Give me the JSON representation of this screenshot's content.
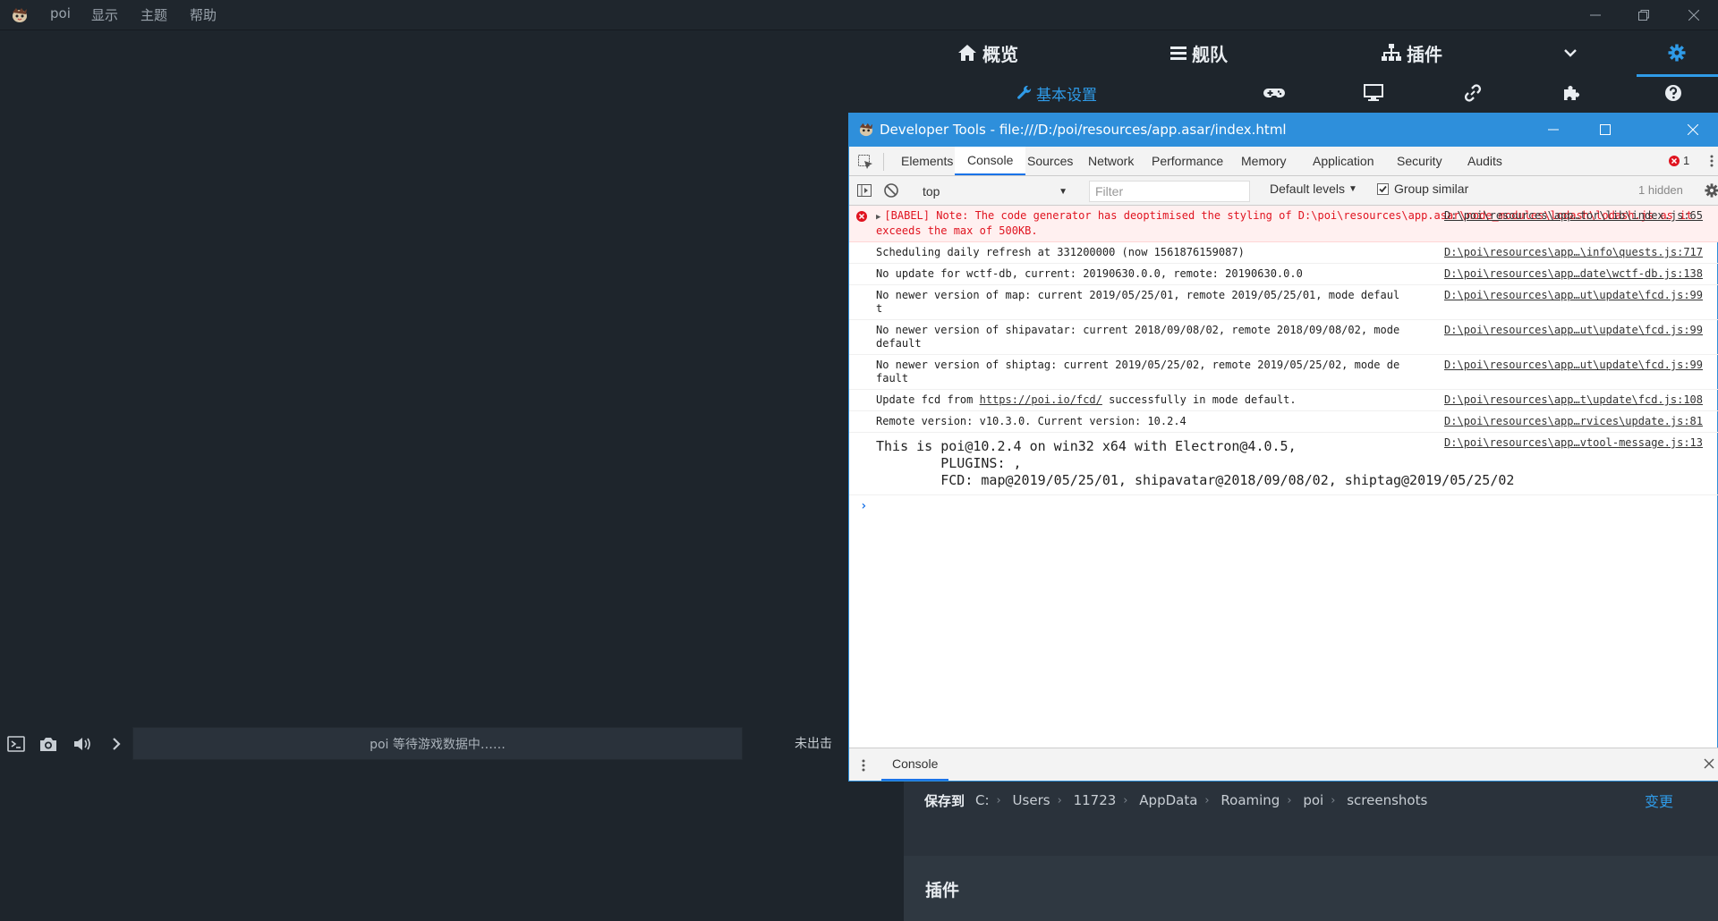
{
  "app": {
    "menu": [
      "poi",
      "显示",
      "主题",
      "帮助"
    ],
    "window_controls": [
      "minimize",
      "restore",
      "close"
    ]
  },
  "nav": {
    "tabs": [
      {
        "label": "概览",
        "icon": "home-icon"
      },
      {
        "label": "舰队",
        "icon": "list-icon"
      },
      {
        "label": "插件",
        "icon": "sitemap-icon"
      }
    ],
    "dropdown_icon": "chevron-down-icon",
    "settings_icon": "gear-icon",
    "subtabs": [
      {
        "label": "基本设置",
        "icon": "wrench-icon",
        "active": true
      },
      {
        "label": "",
        "icon": "gamepad-icon"
      },
      {
        "label": "",
        "icon": "monitor-icon"
      },
      {
        "label": "",
        "icon": "link-icon"
      },
      {
        "label": "",
        "icon": "puzzle-icon"
      },
      {
        "label": "",
        "icon": "question-icon"
      }
    ],
    "accent_color": "#2f9be8"
  },
  "game": {
    "status_text": "poi 等待游戏数据中……",
    "combat_status": "未出击",
    "toolbar_icons": [
      "terminal-icon",
      "camera-icon",
      "volume-icon",
      "chevron-right-icon"
    ]
  },
  "settings": {
    "save_label": "保存到",
    "path": [
      "C:",
      "Users",
      "11723",
      "AppData",
      "Roaming",
      "poi",
      "screenshots"
    ],
    "change_label": "变更",
    "plugins_heading": "插件"
  },
  "devtools": {
    "title": "Developer Tools - file:///D:/poi/resources/app.asar/index.html",
    "tabs": [
      "Elements",
      "Console",
      "Sources",
      "Network",
      "Performance",
      "Memory",
      "Application",
      "Security",
      "Audits"
    ],
    "active_tab": "Console",
    "error_count": "1",
    "context": "top",
    "filter_placeholder": "Filter",
    "levels": "Default levels",
    "group_similar": "Group similar",
    "hidden": "1 hidden",
    "drawer_tab": "Console",
    "logs": [
      {
        "type": "error",
        "message": "[BABEL] Note: The code generator has deoptimised the styling of D:\\poi\\resources\\app.asar\\node_modules\\lodash\\lodash.js as it exceeds the max of 500KB.",
        "source": "D:\\poi\\resources\\app…tor\\lib\\index.js:65"
      },
      {
        "type": "log",
        "message": "Scheduling daily refresh at 331200000 (now 1561876159087)",
        "source": "D:\\poi\\resources\\app…\\info\\quests.js:717"
      },
      {
        "type": "log",
        "message": "No update for wctf-db, current: 20190630.0.0, remote: 20190630.0.0",
        "source": "D:\\poi\\resources\\app…date\\wctf-db.js:138"
      },
      {
        "type": "log",
        "message": "No newer version of map: current 2019/05/25/01, remote 2019/05/25/01, mode default",
        "source": "D:\\poi\\resources\\app…ut\\update\\fcd.js:99"
      },
      {
        "type": "log",
        "message": "No newer version of shipavatar: current 2018/09/08/02, remote 2018/09/08/02, mode default",
        "source": "D:\\poi\\resources\\app…ut\\update\\fcd.js:99"
      },
      {
        "type": "log",
        "message": "No newer version of shiptag: current 2019/05/25/02, remote 2019/05/25/02, mode default",
        "source": "D:\\poi\\resources\\app…ut\\update\\fcd.js:99"
      },
      {
        "type": "log",
        "message_before": "Update fcd from ",
        "message_link": "https://poi.io/fcd/",
        "message_after": " successfully in mode default.",
        "source": "D:\\poi\\resources\\app…t\\update\\fcd.js:108"
      },
      {
        "type": "log",
        "message": "Remote version: v10.3.0. Current version: 10.2.4",
        "source": "D:\\poi\\resources\\app…rvices\\update.js:81"
      },
      {
        "type": "big",
        "message": "This is poi@10.2.4 on win32 x64 with Electron@4.0.5,\n        PLUGINS: ,\n        FCD: map@2019/05/25/01, shipavatar@2018/09/08/02, shiptag@2019/05/25/02",
        "source": "D:\\poi\\resources\\app…vtool-message.js:13"
      }
    ]
  }
}
